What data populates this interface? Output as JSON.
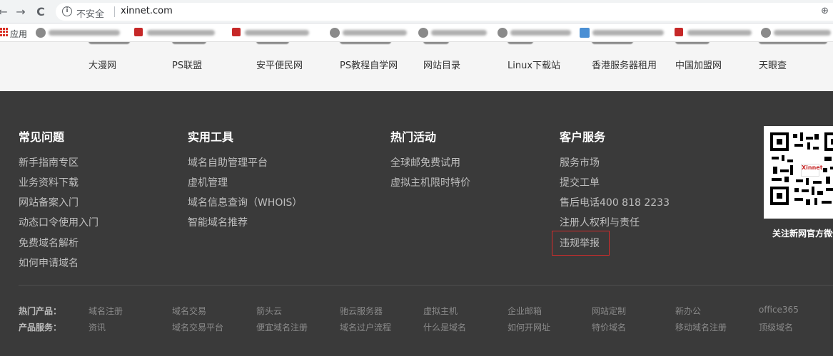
{
  "browser": {
    "insecure_label": "不安全",
    "url": "xinnet.com",
    "back_glyph": "←",
    "forward_glyph": "→",
    "reload_glyph": "C",
    "zoom_glyph": "⊕",
    "info_glyph": "i"
  },
  "bookmarks": {
    "apps_label": "应用"
  },
  "friend_links": [
    "大漫网",
    "PS联盟",
    "安平便民网",
    "PS教程自学网",
    "网站目录",
    "Linux下载站",
    "香港服务器租用",
    "中国加盟网",
    "天眼查"
  ],
  "footer": {
    "columns": [
      {
        "title": "常见问题",
        "links": [
          "新手指南专区",
          "业务资料下载",
          "网站备案入门",
          "动态口令使用入门",
          "免费域名解析",
          "如何申请域名"
        ]
      },
      {
        "title": "实用工具",
        "links": [
          "域名自助管理平台",
          "虚机管理",
          "域名信息查询（WHOIS）",
          "智能域名推荐"
        ]
      },
      {
        "title": "热门活动",
        "links": [
          "全球邮免费试用",
          "虚拟主机限时特价"
        ]
      },
      {
        "title": "客户服务",
        "links": [
          "服务市场",
          "提交工单",
          "售后电话400 818 2233",
          "注册人权利与责任",
          "违规举报"
        ]
      }
    ],
    "qr_caption": "关注新网官方微信",
    "qr_logo_text": "Xinnet",
    "hot_products": {
      "label": "热门产品：",
      "items": [
        "域名注册",
        "域名交易",
        "箭头云",
        "驰云服务器",
        "虚拟主机",
        "企业邮箱",
        "网站定制",
        "新办公",
        "office365"
      ]
    },
    "product_services": {
      "label": "产品服务：",
      "items": [
        "资讯",
        "域名交易平台",
        "便宜域名注册",
        "域名过户流程",
        "什么是域名",
        "如何开网址",
        "特价域名",
        "移动域名注册",
        "顶级域名"
      ]
    }
  },
  "colors": {
    "footer_bg": "#3a3a3a",
    "highlight": "#d52b2b",
    "link_band_bg": "#f5f5f5"
  }
}
